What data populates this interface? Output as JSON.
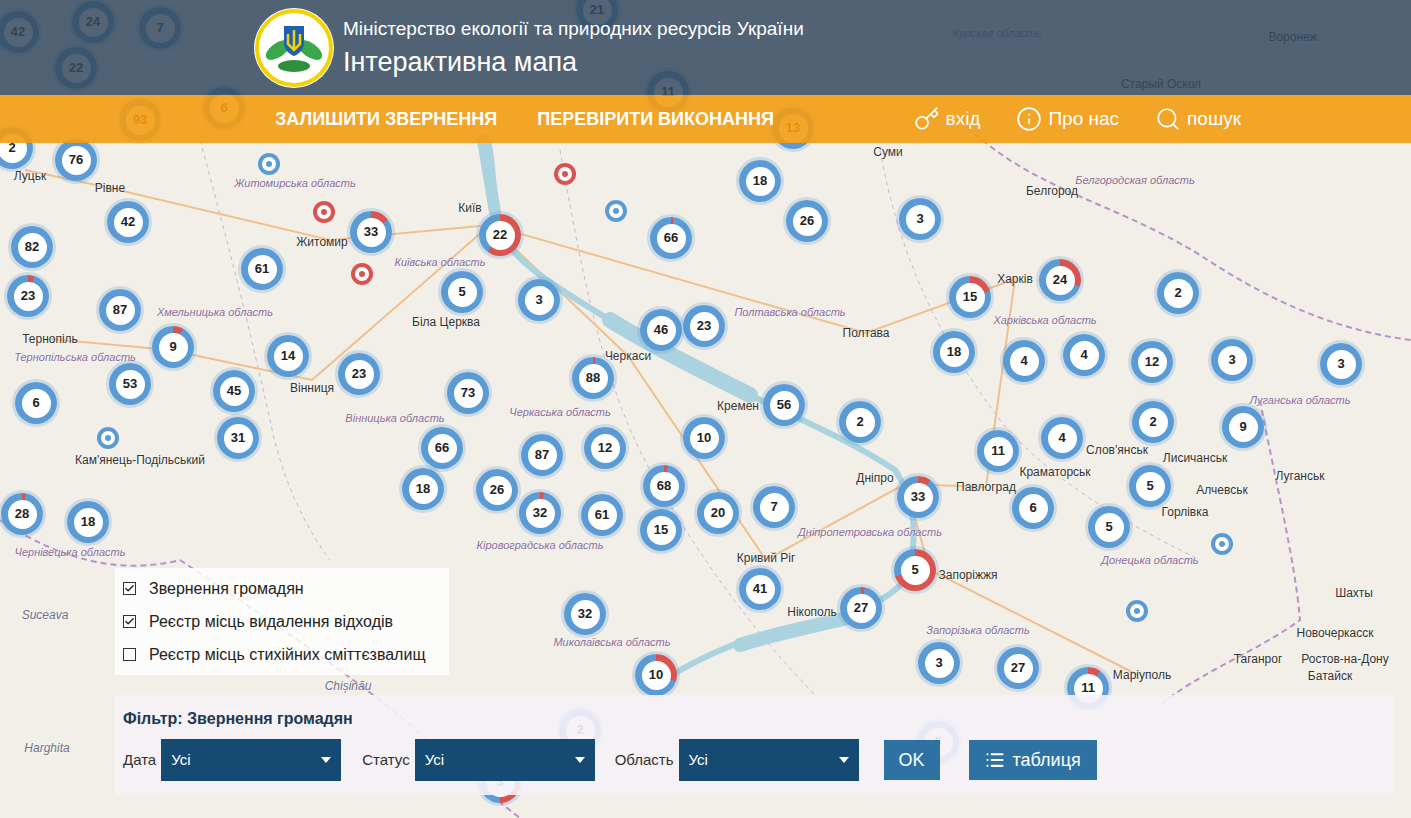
{
  "header": {
    "ministry": "Міністерство екології та природних ресурсів України",
    "title": "Інтерактивна мапа"
  },
  "nav": {
    "primary": [
      {
        "label": "ЗАЛИШИТИ ЗВЕРНЕННЯ"
      },
      {
        "label": "ПЕРЕВІРИТИ ВИКОНАННЯ"
      }
    ],
    "secondary": [
      {
        "label": "вхід",
        "kind": "key"
      },
      {
        "label": "Про нас",
        "kind": "info"
      },
      {
        "label": "пошук",
        "kind": "search"
      }
    ]
  },
  "map": {
    "labels": [
      {
        "text": "Курская область",
        "kind": "region"
      },
      {
        "text": "Воронеж",
        "kind": "city"
      },
      {
        "text": "Старый Оскол",
        "kind": "city"
      },
      {
        "text": "Луцьк",
        "kind": "city"
      },
      {
        "text": "Рівне",
        "kind": "city"
      },
      {
        "text": "Суми",
        "kind": "city"
      },
      {
        "text": "Житомирська область",
        "kind": "region"
      },
      {
        "text": "Житомир",
        "kind": "city"
      },
      {
        "text": "Київ",
        "kind": "city"
      },
      {
        "text": "Київська область",
        "kind": "region"
      },
      {
        "text": "Біла Церква",
        "kind": "city"
      },
      {
        "text": "Белгород",
        "kind": "city"
      },
      {
        "text": "Белгородская область",
        "kind": "region"
      },
      {
        "text": "Харків",
        "kind": "city"
      },
      {
        "text": "Харківська область",
        "kind": "region"
      },
      {
        "text": "Тернопіль",
        "kind": "city"
      },
      {
        "text": "Тернопільська область",
        "kind": "region"
      },
      {
        "text": "Хмельницька область",
        "kind": "region"
      },
      {
        "text": "Вінниця",
        "kind": "city"
      },
      {
        "text": "Вінницька область",
        "kind": "region"
      },
      {
        "text": "Кам'янець-Подільський",
        "kind": "city"
      },
      {
        "text": "Черкаси",
        "kind": "city"
      },
      {
        "text": "Черкаська область",
        "kind": "region"
      },
      {
        "text": "Полтавська область",
        "kind": "region"
      },
      {
        "text": "Полтава",
        "kind": "city"
      },
      {
        "text": "Кремен",
        "kind": "city"
      },
      {
        "text": "Кіровоградська область",
        "kind": "region"
      },
      {
        "text": "Дніпро",
        "kind": "city"
      },
      {
        "text": "Дніпропетровська область",
        "kind": "region"
      },
      {
        "text": "Павлоград",
        "kind": "city"
      },
      {
        "text": "Слов'янськ",
        "kind": "city"
      },
      {
        "text": "Краматорськ",
        "kind": "city"
      },
      {
        "text": "Лисичанськ",
        "kind": "city"
      },
      {
        "text": "Луганська область",
        "kind": "region"
      },
      {
        "text": "Луганськ",
        "kind": "city"
      },
      {
        "text": "Алчевськ",
        "kind": "city"
      },
      {
        "text": "Горлівка",
        "kind": "city"
      },
      {
        "text": "Донецька область",
        "kind": "region"
      },
      {
        "text": "Кривий Ріг",
        "kind": "city"
      },
      {
        "text": "Запоріжжя",
        "kind": "city"
      },
      {
        "text": "Нікополь",
        "kind": "city"
      },
      {
        "text": "Запорізька область",
        "kind": "region"
      },
      {
        "text": "Маріуполь",
        "kind": "city"
      },
      {
        "text": "Шахты",
        "kind": "city"
      },
      {
        "text": "Новочеркасск",
        "kind": "city"
      },
      {
        "text": "Таганрог",
        "kind": "city"
      },
      {
        "text": "Ростов-на-Дону",
        "kind": "city"
      },
      {
        "text": "Батайск",
        "kind": "city"
      },
      {
        "text": "Чернівецька область",
        "kind": "region"
      },
      {
        "text": "Миколаївська область",
        "kind": "region"
      },
      {
        "text": "Chișinău",
        "kind": "foreign"
      },
      {
        "text": "Suceava",
        "kind": "foreign"
      },
      {
        "text": "Harghita",
        "kind": "foreign"
      }
    ],
    "clusters": [
      {
        "count": "42",
        "level": 0
      },
      {
        "count": "24",
        "level": 0
      },
      {
        "count": "22",
        "level": 0
      },
      {
        "count": "7",
        "level": 0
      },
      {
        "count": "21",
        "level": 0
      },
      {
        "count": "11",
        "level": 0
      },
      {
        "count": "93",
        "level": 0
      },
      {
        "count": "6",
        "level": 0
      },
      {
        "count": "13",
        "level": 0
      },
      {
        "count": "2",
        "level": 0
      },
      {
        "count": "76",
        "level": 0
      },
      {
        "count": "42",
        "level": 0
      },
      {
        "count": "82",
        "level": 0
      },
      {
        "count": "23",
        "level": 0.05
      },
      {
        "count": "87",
        "level": 0
      },
      {
        "count": "9",
        "level": 0.08
      },
      {
        "count": "61",
        "level": 0
      },
      {
        "count": "33",
        "level": 0.15
      },
      {
        "count": "22",
        "level": 0.6
      },
      {
        "count": "5",
        "level": 0
      },
      {
        "count": "3",
        "level": 0
      },
      {
        "count": "66",
        "level": 0.02
      },
      {
        "count": "18",
        "level": 0
      },
      {
        "count": "26",
        "level": 0
      },
      {
        "count": "3",
        "level": 0
      },
      {
        "count": "46",
        "level": 0
      },
      {
        "count": "23",
        "level": 0
      },
      {
        "count": "88",
        "level": 0.02
      },
      {
        "count": "14",
        "level": 0
      },
      {
        "count": "53",
        "level": 0
      },
      {
        "count": "45",
        "level": 0
      },
      {
        "count": "23",
        "level": 0
      },
      {
        "count": "73",
        "level": 0
      },
      {
        "count": "6",
        "level": 0
      },
      {
        "count": "31",
        "level": 0
      },
      {
        "count": "66",
        "level": 0
      },
      {
        "count": "87",
        "level": 0
      },
      {
        "count": "12",
        "level": 0
      },
      {
        "count": "10",
        "level": 0
      },
      {
        "count": "56",
        "level": 0
      },
      {
        "count": "2",
        "level": 0
      },
      {
        "count": "18",
        "level": 0
      },
      {
        "count": "26",
        "level": 0
      },
      {
        "count": "32",
        "level": 0.03
      },
      {
        "count": "61",
        "level": 0
      },
      {
        "count": "68",
        "level": 0.03
      },
      {
        "count": "15",
        "level": 0
      },
      {
        "count": "20",
        "level": 0
      },
      {
        "count": "7",
        "level": 0
      },
      {
        "count": "28",
        "level": 0.03
      },
      {
        "count": "18",
        "level": 0
      },
      {
        "count": "15",
        "level": 0.2
      },
      {
        "count": "24",
        "level": 0.3
      },
      {
        "count": "2",
        "level": 0
      },
      {
        "count": "18",
        "level": 0
      },
      {
        "count": "4",
        "level": 0
      },
      {
        "count": "4",
        "level": 0
      },
      {
        "count": "12",
        "level": 0
      },
      {
        "count": "3",
        "level": 0
      },
      {
        "count": "3",
        "level": 0
      },
      {
        "count": "2",
        "level": 0
      },
      {
        "count": "9",
        "level": 0
      },
      {
        "count": "11",
        "level": 0
      },
      {
        "count": "4",
        "level": 0
      },
      {
        "count": "5",
        "level": 0
      },
      {
        "count": "33",
        "level": 0.1
      },
      {
        "count": "6",
        "level": 0
      },
      {
        "count": "5",
        "level": 0
      },
      {
        "count": "5",
        "level": 0.7
      },
      {
        "count": "41",
        "level": 0
      },
      {
        "count": "27",
        "level": 0.03
      },
      {
        "count": "32",
        "level": 0
      },
      {
        "count": "10",
        "level": 0.3
      },
      {
        "count": "3",
        "level": 0
      },
      {
        "count": "27",
        "level": 0
      },
      {
        "count": "11",
        "level": 0.1
      },
      {
        "count": "2",
        "level": 0
      },
      {
        "count": "5",
        "level": 0
      },
      {
        "count": "3",
        "level": 0.5
      }
    ],
    "points": [
      {
        "color": "#d9534f"
      },
      {
        "color": "#d9534f"
      },
      {
        "color": "#d9534f"
      },
      {
        "color": "#5b9bd5"
      },
      {
        "color": "#5b9bd5"
      },
      {
        "color": "#5b9bd5"
      },
      {
        "color": "#5b9bd5"
      },
      {
        "color": "#5b9bd5"
      }
    ]
  },
  "layers": [
    {
      "label": "Звернення громадян",
      "checked": true
    },
    {
      "label": "Реєстр місць видалення відходів",
      "checked": true
    },
    {
      "label": "Реєстр місць стихійних сміттєзвалищ",
      "checked": false
    }
  ],
  "filter": {
    "title": "Фільтр: Звернення громадян",
    "fields": [
      {
        "label": "Дата",
        "value": "Усі"
      },
      {
        "label": "Статус",
        "value": "Усі"
      },
      {
        "label": "Область",
        "value": "Усі"
      }
    ],
    "ok": "OK",
    "table": "таблиця"
  }
}
